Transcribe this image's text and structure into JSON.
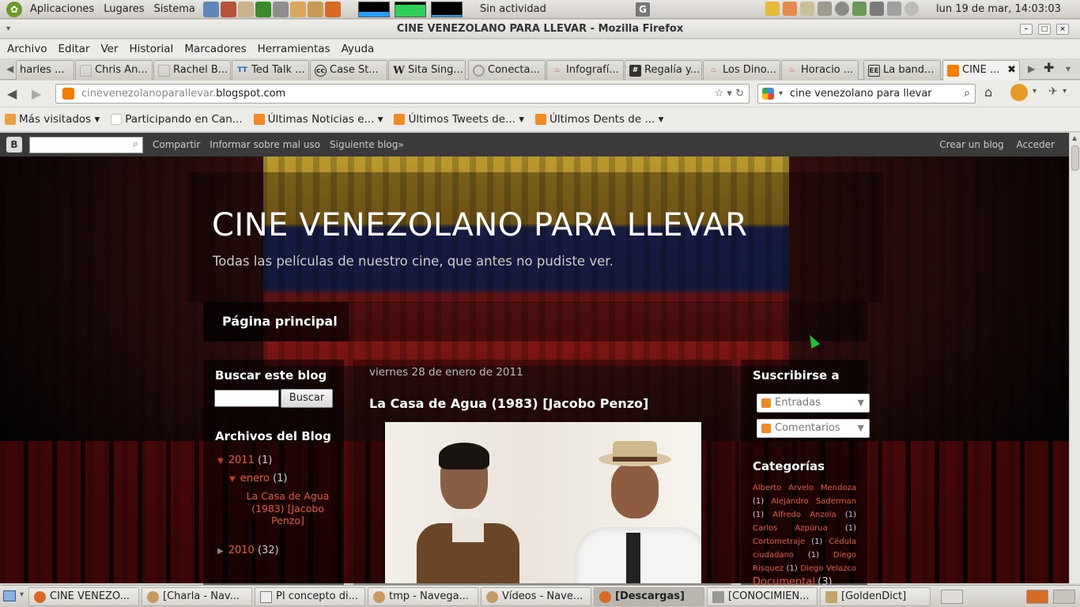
{
  "top_panel": {
    "menus": [
      "Aplicaciones",
      "Lugares",
      "Sistema"
    ],
    "activity": "Sin actividad",
    "g_label": "G",
    "clock": "lun 19 de mar, 14:03:03"
  },
  "window": {
    "title": "CINE VENEZOLANO PARA LLEVAR - Mozilla Firefox",
    "menu": [
      "Archivo",
      "Editar",
      "Ver",
      "Historial",
      "Marcadores",
      "Herramientas",
      "Ayuda"
    ]
  },
  "tabs": [
    {
      "label": "harles ...",
      "icon_text": ""
    },
    {
      "label": "Chris An...",
      "icon_text": ""
    },
    {
      "label": "Rachel B...",
      "icon_text": ""
    },
    {
      "label": "Ted Talk ...",
      "icon_text": "TT"
    },
    {
      "label": "Case St...",
      "icon_text": "cc"
    },
    {
      "label": "Sita Sing...",
      "icon_text": "W"
    },
    {
      "label": "Conecta...",
      "icon_text": ""
    },
    {
      "label": "Infografí...",
      "icon_text": ""
    },
    {
      "label": "Regalía y...",
      "icon_text": ""
    },
    {
      "label": "Los Dino...",
      "icon_text": ""
    },
    {
      "label": "Horacio ...",
      "icon_text": ""
    },
    {
      "label": "La band...",
      "icon_text": "EE"
    },
    {
      "label": "CINE ...",
      "icon_text": ""
    }
  ],
  "urlbar": {
    "prefix": "cinevenezolanoparallevar.",
    "host": "blogspot.com"
  },
  "search": {
    "value": "cine venezolano para llevar"
  },
  "bookmarks": [
    {
      "label": "Más visitados ▾",
      "icon": "folder-icon"
    },
    {
      "label": "Participando en Can...",
      "icon": "page-icon"
    },
    {
      "label": "Últimas Noticias e... ▾",
      "icon": "rss-icon"
    },
    {
      "label": "Últimos Tweets de... ▾",
      "icon": "rss-icon"
    },
    {
      "label": "Últimos Dents de ... ▾",
      "icon": "rss-icon"
    }
  ],
  "blogger_nav": {
    "logo": "B",
    "links": [
      "Compartir",
      "Informar sobre mal uso",
      "Siguiente blog»"
    ],
    "right": [
      "Crear un blog",
      "Acceder"
    ]
  },
  "blog": {
    "title": "CINE VENEZOLANO PARA LLEVAR",
    "description": "Todas las películas de nuestro cine, que antes no pudiste ver.",
    "home_tab": "Página principal",
    "search_title": "Buscar este blog",
    "search_button": "Buscar",
    "archive_title": "Archivos del Blog",
    "archive": {
      "y2011": {
        "label": "2011",
        "count": "(1)"
      },
      "enero": {
        "label": "enero",
        "count": "(1)"
      },
      "post": "La Casa de Agua (1983) [Jacobo Penzo]",
      "y2010": {
        "label": "2010",
        "count": "(32)"
      }
    },
    "post_date": "viernes 28 de enero de 2011",
    "post_title": "La Casa de Agua (1983) [Jacobo Penzo]",
    "subscribe_title": "Suscribirse a",
    "feeds": [
      "Entradas",
      "Comentarios"
    ],
    "categories_title": "Categorías",
    "categories": [
      {
        "name": "Alberto Arvelo Mendoza",
        "count": "(1)"
      },
      {
        "name": "Alejandro Saderman",
        "count": "(1)"
      },
      {
        "name": "Alfredo Anzola",
        "count": "(1)"
      },
      {
        "name": "Carlos Azpúrua",
        "count": "(1)"
      },
      {
        "name": "Cortometraje",
        "count": "(1)"
      },
      {
        "name": "Cédula ciudadano",
        "count": "(1)"
      },
      {
        "name": "Diego Risquez",
        "count": "(1)"
      },
      {
        "name": "Diego Velazco",
        "count": ""
      },
      {
        "name": "Documental",
        "count": "(3)"
      }
    ]
  },
  "taskbar": [
    {
      "label": "CINE VENEZO...",
      "active": false
    },
    {
      "label": "[Charla - Nav...",
      "active": false
    },
    {
      "label": "PI concepto di...",
      "active": false
    },
    {
      "label": "tmp - Navega...",
      "active": false
    },
    {
      "label": "Vídeos - Nave...",
      "active": false
    },
    {
      "label": "[Descargas]",
      "active": true
    },
    {
      "label": "[CONOCIMIEN...",
      "active": false
    },
    {
      "label": "[GoldenDict]",
      "active": false
    }
  ]
}
